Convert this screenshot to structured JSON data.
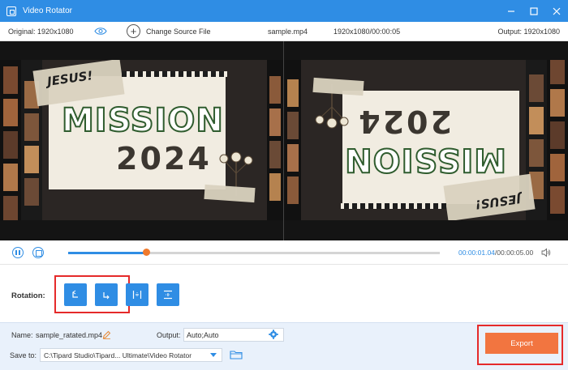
{
  "window": {
    "title": "Video Rotator",
    "icon": "app-icon",
    "controls": [
      "minimize-icon",
      "maximize-icon",
      "close-icon"
    ]
  },
  "infobar": {
    "original": "Original: 1920x1080",
    "change_source": "Change Source File",
    "file_name": "sample.mp4",
    "resolution_duration": "1920x1080/00:00:05",
    "output": "Output: 1920x1080"
  },
  "video": {
    "badge_text": "JESUS!",
    "headline": "MISSION",
    "year": "2024"
  },
  "playback": {
    "current_time": "00:00:01.04",
    "separator": "/",
    "total_time": "00:00:05.00",
    "progress_fraction": 0.21
  },
  "rotation": {
    "label": "Rotation:",
    "buttons": [
      "rotate-left-icon",
      "rotate-right-icon",
      "flip-horizontal-icon",
      "flip-vertical-icon"
    ]
  },
  "bottom": {
    "name_label": "Name:",
    "name_value": "sample_ratated.mp4",
    "output_label": "Output:",
    "output_value": "Auto;Auto",
    "save_label": "Save to:",
    "save_path": "C:\\Tipard Studio\\Tipard... Ultimate\\Video Rotator",
    "export_label": "Export"
  },
  "colors": {
    "accent": "#2f8de4",
    "export": "#f27540",
    "highlight": "#e52a2a"
  }
}
